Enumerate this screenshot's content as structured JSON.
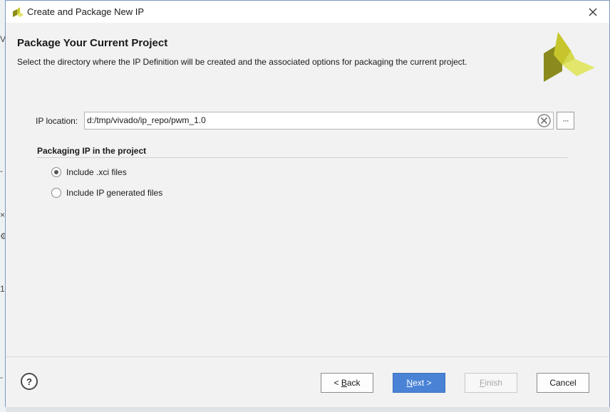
{
  "window": {
    "title": "Create and Package New IP",
    "close_icon": "close-icon"
  },
  "header": {
    "title": "Package Your Current Project",
    "description": "Select the directory where the IP Definition will be created and the associated options for packaging the current project.",
    "logo": "vivado-logo",
    "logo_colors": [
      "#8a8a1e",
      "#c6c62c",
      "#e2e66a"
    ]
  },
  "ip_location": {
    "label": "IP location:",
    "value": "d:/tmp/vivado/ip_repo/pwm_1.0",
    "browse_label": "···",
    "clear_icon": "clear-icon"
  },
  "packaging": {
    "group_title": "Packaging IP in the project",
    "options": [
      {
        "label": "Include .xci files",
        "selected": true
      },
      {
        "label": "Include IP generated files",
        "selected": false
      }
    ]
  },
  "footer": {
    "help_label": "?",
    "back_prefix": "< ",
    "back_mnemonic": "B",
    "back_rest": "ack",
    "next_mnemonic": "N",
    "next_rest": "ext >",
    "finish_mnemonic": "F",
    "finish_rest": "inish",
    "cancel_label": "Cancel",
    "primary_color": "#4a83d6"
  },
  "background_app": {
    "marks": [
      "V",
      "-",
      "×",
      "⚙",
      "1",
      "-"
    ]
  }
}
